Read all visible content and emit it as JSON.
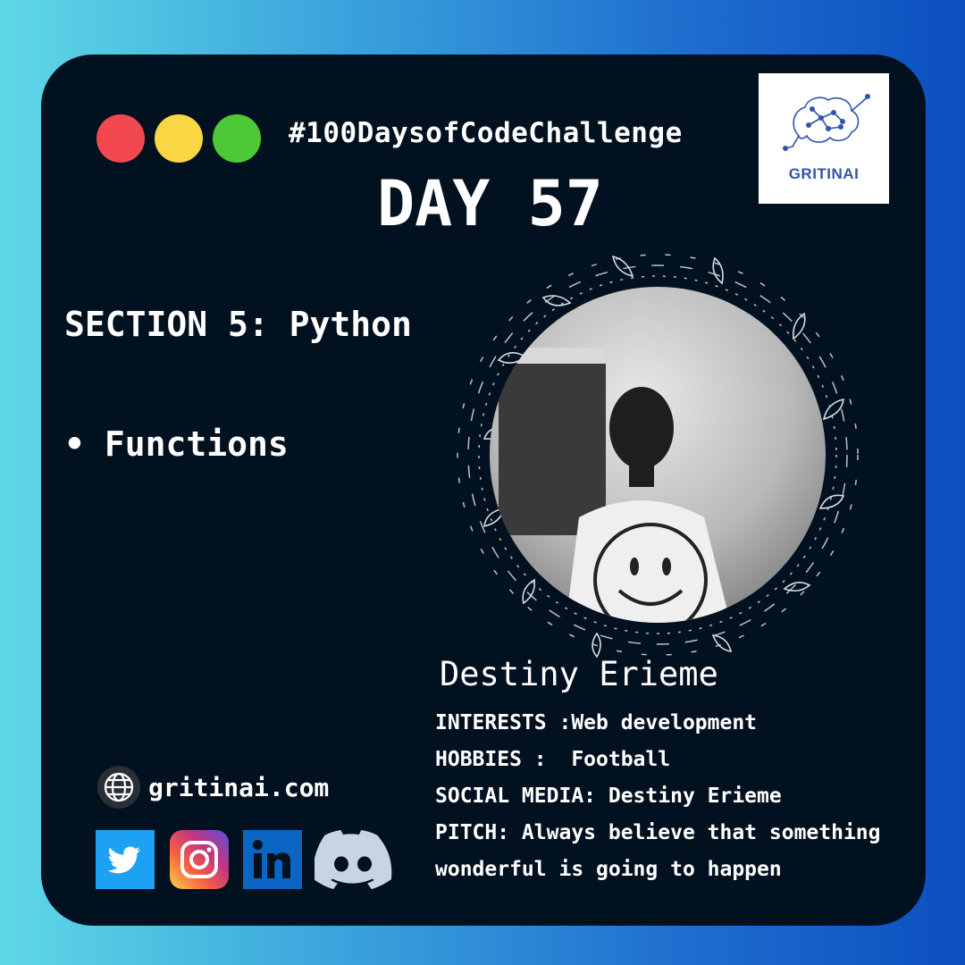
{
  "header": {
    "hashtag": "#100DaysofCodeChallenge",
    "day": "DAY 57"
  },
  "logo": {
    "text": "GRITINAI"
  },
  "content": {
    "section": "SECTION 5: Python",
    "bullet": "•",
    "topic": "Functions"
  },
  "profile": {
    "name": "Destiny Erieme",
    "details": [
      "INTERESTS :Web development",
      "HOBBIES :  Football",
      "SOCIAL MEDIA: Destiny Erieme",
      "PITCH: Always believe that something wonderful is going to happen"
    ]
  },
  "footer": {
    "website": "gritinai.com",
    "social_icons": [
      "twitter-icon",
      "instagram-icon",
      "linkedin-icon",
      "discord-icon"
    ]
  },
  "colors": {
    "card_bg": "#02111f",
    "dot_red": "#f1494f",
    "dot_yellow": "#fbd644",
    "dot_green": "#4dc937",
    "brand_blue": "#2e56a8"
  }
}
